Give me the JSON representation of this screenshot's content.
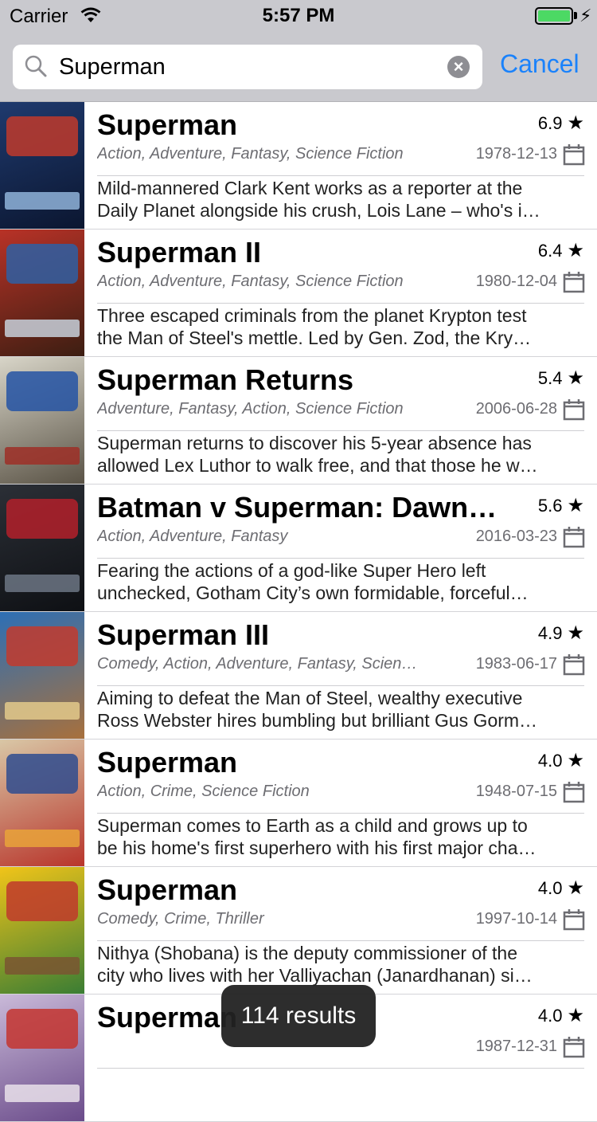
{
  "status_bar": {
    "carrier": "Carrier",
    "time": "5:57 PM"
  },
  "search": {
    "query": "Superman",
    "cancel_label": "Cancel"
  },
  "results": [
    {
      "title": "Superman",
      "rating": "6.9",
      "genres": "Action, Adventure, Fantasy, Science Fiction",
      "date": "1978-12-13",
      "overview_lines": [
        "Mild-mannered Clark Kent works as a reporter at the",
        "Daily Planet alongside his crush, Lois Lane – who's i…"
      ],
      "poster_colors": [
        "#1f3a6e",
        "#0b1630",
        "#c0392b",
        "#8fb3d9"
      ]
    },
    {
      "title": "Superman II",
      "rating": "6.4",
      "genres": "Action, Adventure, Fantasy, Science Fiction",
      "date": "1980-12-04",
      "overview_lines": [
        "Three escaped criminals from the planet Krypton test",
        "the Man of Steel's mettle. Led by Gen. Zod, the Kry…"
      ],
      "poster_colors": [
        "#b83227",
        "#3c1e12",
        "#2e5fa3",
        "#c7d0db"
      ]
    },
    {
      "title": "Superman Returns",
      "rating": "5.4",
      "genres": "Adventure, Fantasy, Action, Science Fiction",
      "date": "2006-06-28",
      "overview_lines": [
        "Superman returns to discover his 5-year absence has",
        "allowed Lex Luthor to walk free, and that those he w…"
      ],
      "poster_colors": [
        "#d8d5c8",
        "#5a5346",
        "#2454a4",
        "#9d2f27"
      ]
    },
    {
      "title": "Batman v Superman: Dawn…",
      "rating": "5.6",
      "genres": "Action, Adventure, Fantasy",
      "date": "2016-03-23",
      "overview_lines": [
        "Fearing the actions of a god-like Super Hero left",
        "unchecked, Gotham City’s own formidable, forceful…"
      ],
      "poster_colors": [
        "#2b2f36",
        "#0e1014",
        "#b3202a",
        "#6c7684"
      ]
    },
    {
      "title": "Superman III",
      "rating": "4.9",
      "genres": "Comedy, Action, Adventure, Fantasy, Scien…",
      "date": "1983-06-17",
      "overview_lines": [
        "Aiming to defeat the Man of Steel, wealthy executive",
        "Ross Webster hires bumbling but brilliant Gus Gorm…"
      ],
      "poster_colors": [
        "#2d6fb5",
        "#a8703c",
        "#c23b2e",
        "#e3c98b"
      ]
    },
    {
      "title": "Superman",
      "rating": "4.0",
      "genres": "Action, Crime, Science Fiction",
      "date": "1948-07-15",
      "overview_lines": [
        "Superman comes to Earth as a child and grows up to",
        "be his home's first superhero with his first major cha…"
      ],
      "poster_colors": [
        "#d9c7a6",
        "#b8352b",
        "#2f4c8f",
        "#e9a33a"
      ]
    },
    {
      "title": "Superman",
      "rating": "4.0",
      "genres": "Comedy, Crime, Thriller",
      "date": "1997-10-14",
      "overview_lines": [
        "Nithya (Shobana) is the deputy commissioner of the",
        "city who lives with her Valliyachan (Janardhanan) si…"
      ],
      "poster_colors": [
        "#f0c419",
        "#3a7d34",
        "#c0392b",
        "#7a5531"
      ]
    },
    {
      "title": "Superman",
      "rating": "4.0",
      "genres": "",
      "date": "1987-12-31",
      "overview_lines": [],
      "poster_colors": [
        "#c9b9d8",
        "#6a4b8a",
        "#c4352f",
        "#e9e0ea"
      ]
    }
  ],
  "toast": {
    "text": "114 results"
  }
}
